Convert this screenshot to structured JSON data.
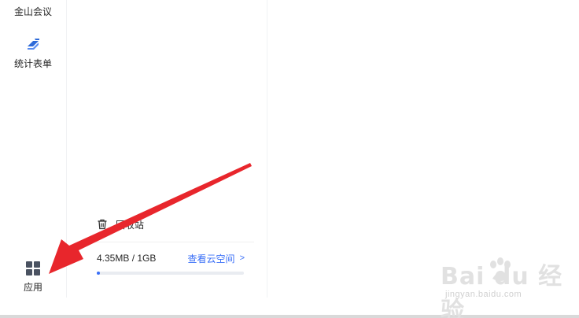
{
  "rail": {
    "items": [
      {
        "label": "金山会议",
        "icon": "meeting-icon"
      },
      {
        "label": "统计表单",
        "icon": "form-icon"
      },
      {
        "label": "应用",
        "icon": "apps-grid-icon"
      }
    ]
  },
  "panel": {
    "trash_label": "回收站",
    "storage": {
      "used_text": "4.35MB / 1GB",
      "link_text": "查看云空间",
      "link_chevron": ">",
      "used_fraction": 0.004
    }
  },
  "watermark": {
    "brand": "Bai du 经验",
    "url": "jingyan.baidu.com"
  },
  "colors": {
    "accent": "#3a6ff7",
    "arrow": "#e8262c",
    "form_icon": "#2f6bd8"
  }
}
